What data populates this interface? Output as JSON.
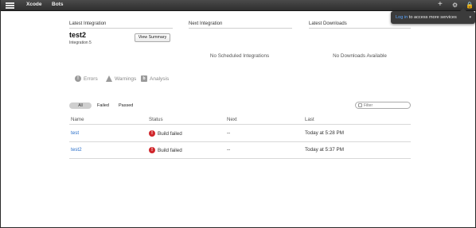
{
  "topbar": {
    "menu_icon": "hamburger-menu-icon",
    "nav": [
      "Xcode",
      "Bots"
    ],
    "icons": {
      "add": "plus-icon",
      "settings": "gear-icon",
      "lock": "lock-icon"
    }
  },
  "popover": {
    "login_link": "Log in",
    "message": " to access more services",
    "caret": "▾"
  },
  "summary": {
    "latest_integration_header": "Latest Integration",
    "next_integration_header": "Next Integration",
    "latest_downloads_header": "Latest Downloads",
    "bot_name": "test2",
    "integration_label": "Integration 5",
    "view_summary_button": "View Summary",
    "no_scheduled": "No Scheduled Integrations",
    "no_downloads": "No Downloads Available"
  },
  "issue_tabs": {
    "errors": "Errors",
    "warnings": "Warnings",
    "analysis": "Analysis",
    "error_glyph": "!",
    "analysis_glyph": "b"
  },
  "filters": {
    "all": "All",
    "failed": "Failed",
    "passed": "Passed",
    "search_placeholder": "Filter"
  },
  "table": {
    "columns": [
      "Name",
      "Status",
      "Next",
      "Last"
    ],
    "rows": [
      {
        "name": "test",
        "status": "Build failed",
        "next": "--",
        "last": "Today at 5:28 PM"
      },
      {
        "name": "test2",
        "status": "Build failed",
        "next": "--",
        "last": "Today at 5:37 PM"
      }
    ],
    "fail_glyph": "!"
  },
  "colors": {
    "topbar": "#3a3a3a",
    "link": "#2a6fc9",
    "failure": "#d0262b",
    "popover_link": "#5da7ff"
  }
}
